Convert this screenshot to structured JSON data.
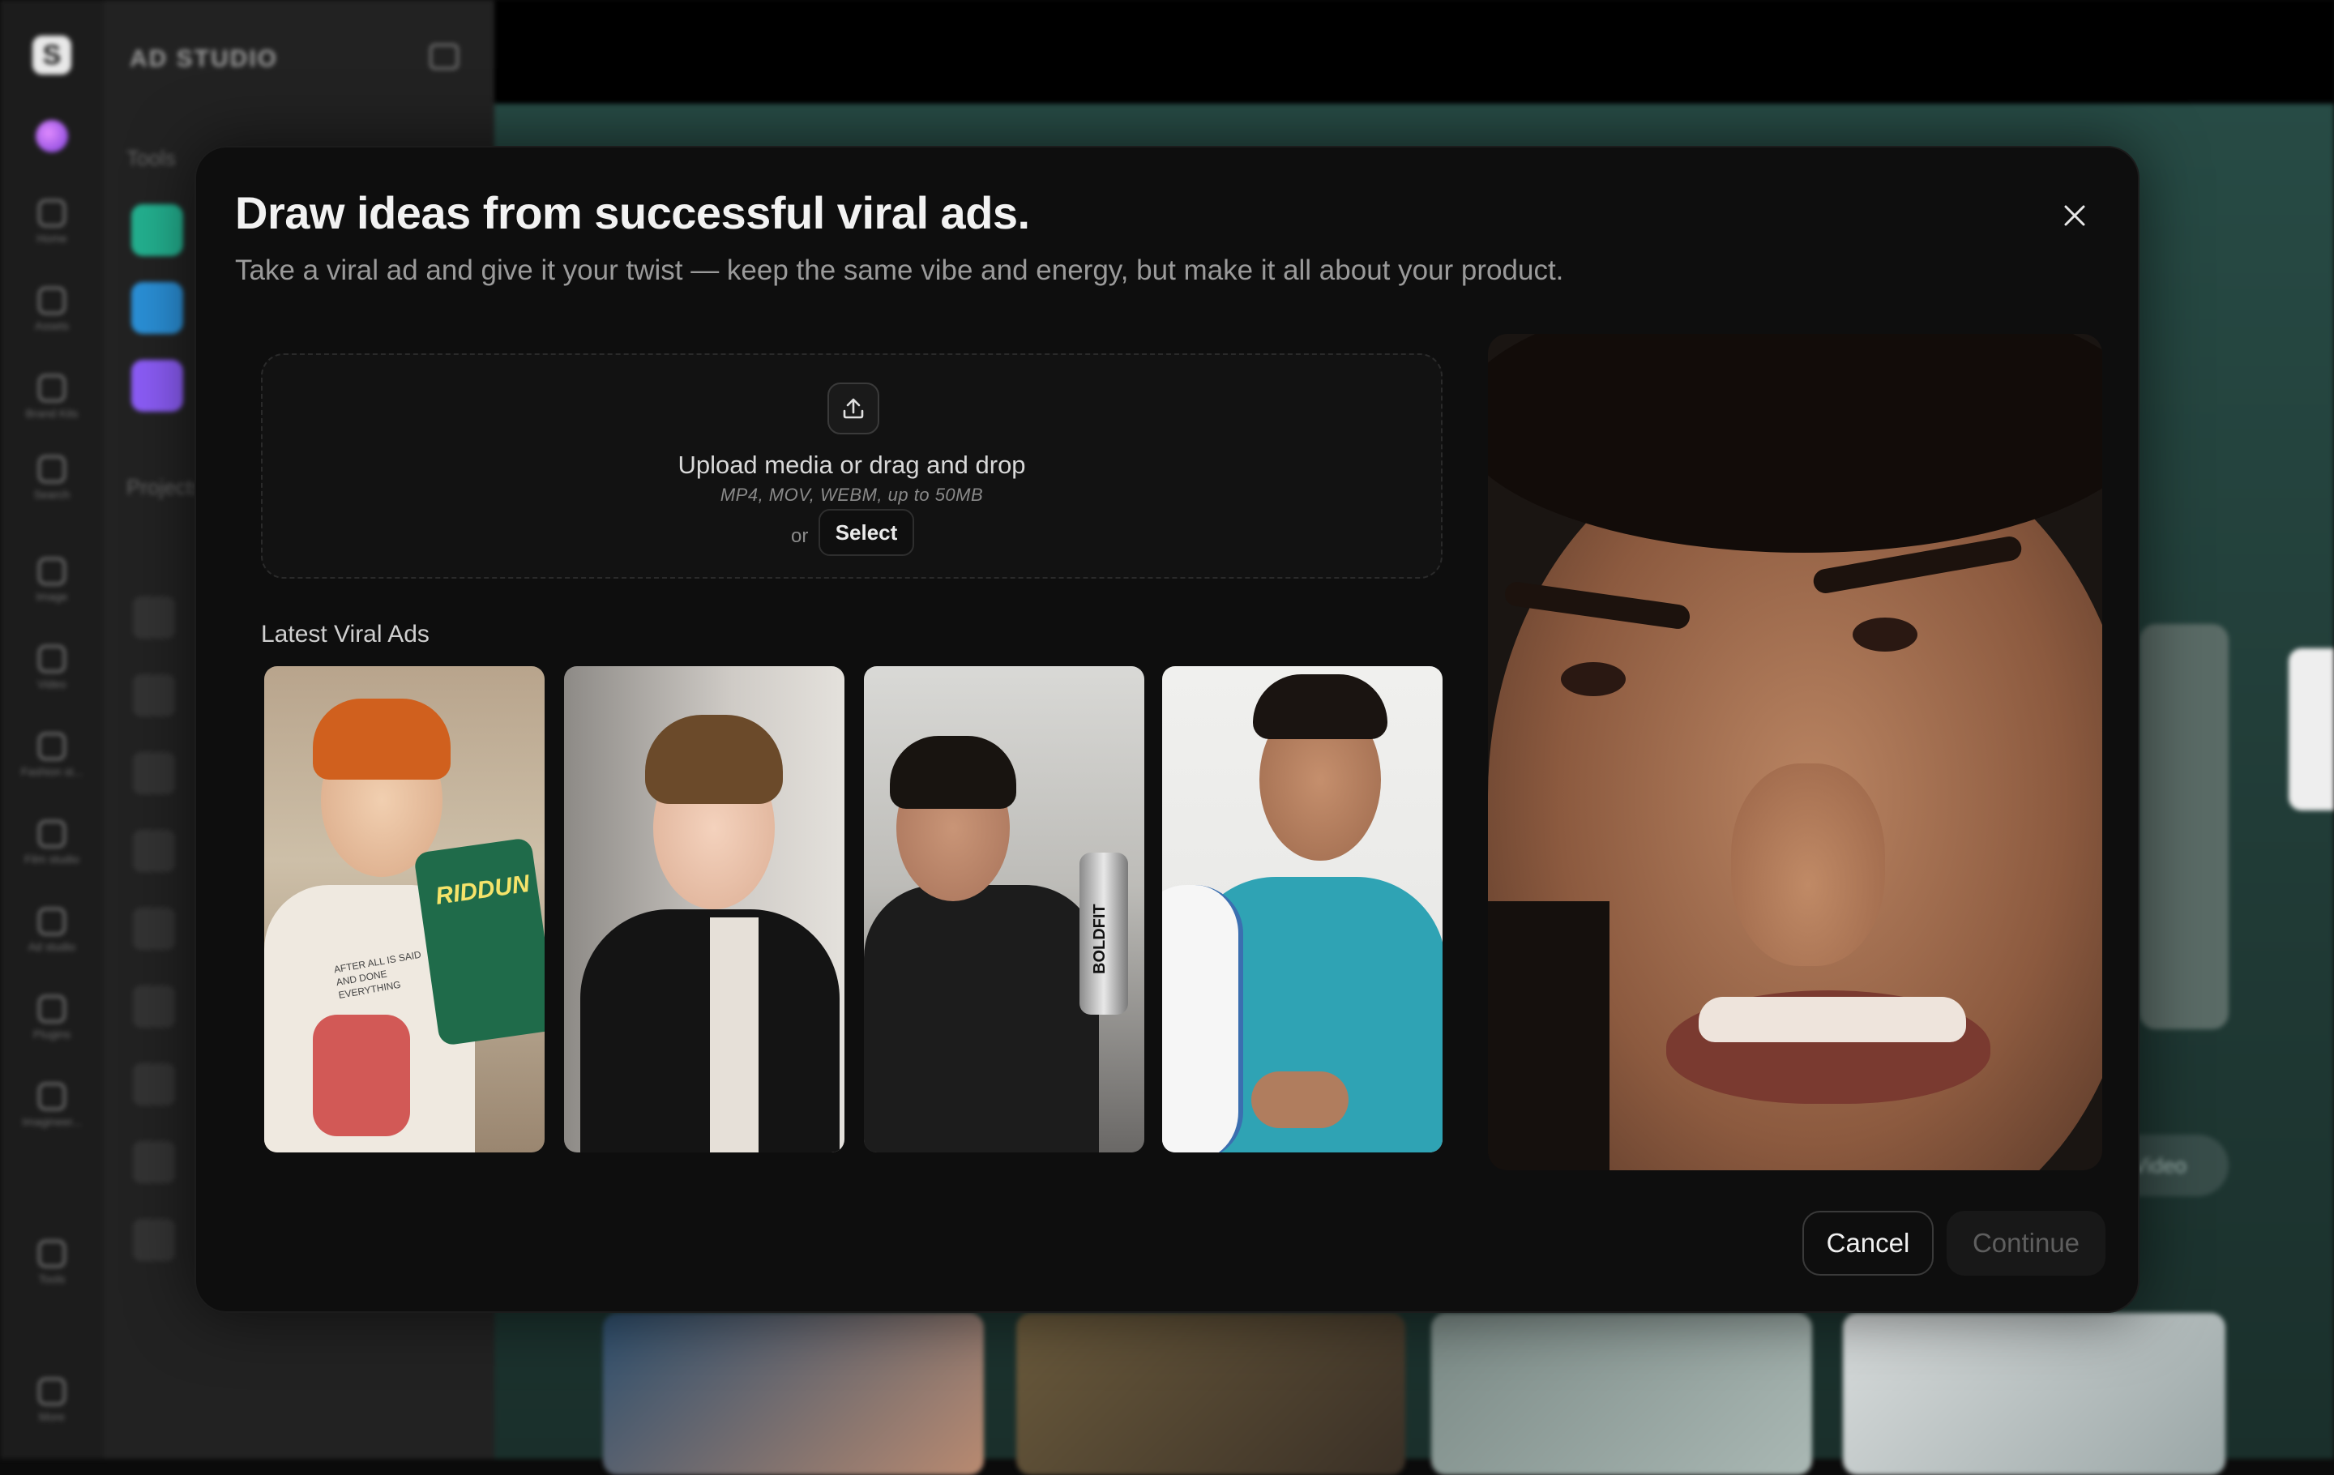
{
  "app": {
    "sidebar_title": "AD STUDIO",
    "tools_heading": "Tools",
    "projects_heading": "Projects",
    "rail": [
      {
        "label": "Home",
        "icon": "home-icon"
      },
      {
        "label": "Assets",
        "icon": "assets-icon"
      },
      {
        "label": "Brand Kits",
        "icon": "brand-kits-icon"
      },
      {
        "label": "Search",
        "icon": "search-icon"
      },
      {
        "label": "Image",
        "icon": "image-icon"
      },
      {
        "label": "Video",
        "icon": "video-icon"
      },
      {
        "label": "Fashion st...",
        "icon": "fashion-icon"
      },
      {
        "label": "Film studio",
        "icon": "film-icon"
      },
      {
        "label": "Ad studio",
        "icon": "ad-studio-icon"
      },
      {
        "label": "Plugins",
        "icon": "plugins-icon"
      },
      {
        "label": "Imagineer...",
        "icon": "imagineer-icon"
      },
      {
        "label": "Tools",
        "icon": "tools-icon"
      },
      {
        "label": "More",
        "icon": "more-icon"
      }
    ],
    "canvas_pill": "Video"
  },
  "modal": {
    "title": "Draw ideas from successful viral ads.",
    "subtitle": "Take a viral ad and give it your twist — keep the same vibe and energy, but make it all about your product.",
    "upload": {
      "title": "Upload media or drag and drop",
      "formats": "MP4, MOV, WEBM, up to 50MB",
      "or_label": "or",
      "select_label": "Select"
    },
    "viral_ads_heading": "Latest Viral Ads",
    "viral_ads": [
      {
        "name": "viral-ad-chips",
        "prop_text": "RIDDUN",
        "shirt_text": "AFTER ALL IS SAID AND DONE EVERYTHING"
      },
      {
        "name": "viral-ad-jacket",
        "prop_text": ""
      },
      {
        "name": "viral-ad-shaker",
        "prop_text": "BOLDFIT"
      },
      {
        "name": "viral-ad-tee",
        "prop_text": ""
      }
    ],
    "cancel_label": "Cancel",
    "continue_label": "Continue"
  },
  "colors": {
    "modal_bg": "#0e0e0e",
    "canvas_bg": "#274b45",
    "accent_purple": "#8b5cf6"
  }
}
